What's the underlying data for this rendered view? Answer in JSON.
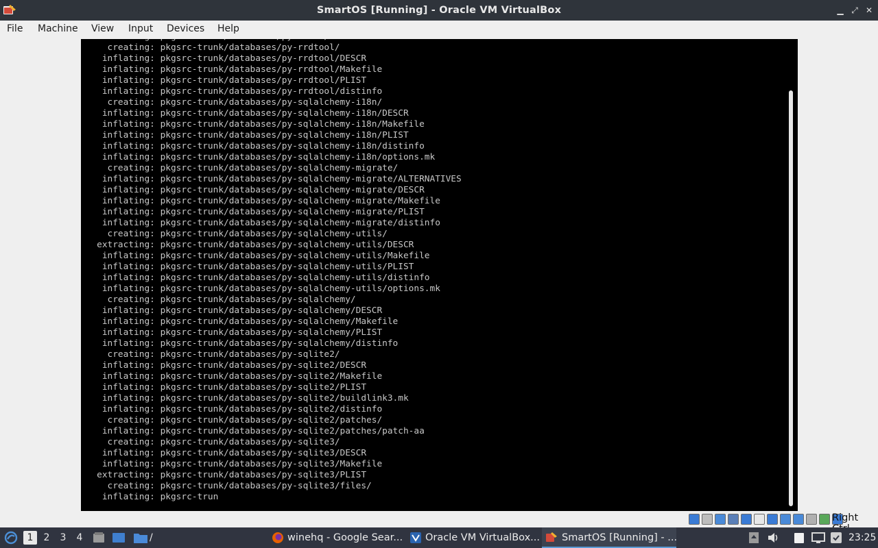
{
  "window": {
    "title": "SmartOS [Running] - Oracle VM VirtualBox",
    "controls": {
      "minimize": "▁",
      "restore": "⤢",
      "close": "✕"
    }
  },
  "menu": [
    "File",
    "Machine",
    "Input",
    "Devices",
    "Help"
  ],
  "menu_view": "View",
  "console_lines": [
    "    inflating: pkgsrc-trunk/databases/py-redis/distinfo",
    "     creating: pkgsrc-trunk/databases/py-rrdtool/",
    "    inflating: pkgsrc-trunk/databases/py-rrdtool/DESCR",
    "    inflating: pkgsrc-trunk/databases/py-rrdtool/Makefile",
    "    inflating: pkgsrc-trunk/databases/py-rrdtool/PLIST",
    "    inflating: pkgsrc-trunk/databases/py-rrdtool/distinfo",
    "     creating: pkgsrc-trunk/databases/py-sqlalchemy-i18n/",
    "    inflating: pkgsrc-trunk/databases/py-sqlalchemy-i18n/DESCR",
    "    inflating: pkgsrc-trunk/databases/py-sqlalchemy-i18n/Makefile",
    "    inflating: pkgsrc-trunk/databases/py-sqlalchemy-i18n/PLIST",
    "    inflating: pkgsrc-trunk/databases/py-sqlalchemy-i18n/distinfo",
    "    inflating: pkgsrc-trunk/databases/py-sqlalchemy-i18n/options.mk",
    "     creating: pkgsrc-trunk/databases/py-sqlalchemy-migrate/",
    "    inflating: pkgsrc-trunk/databases/py-sqlalchemy-migrate/ALTERNATIVES",
    "    inflating: pkgsrc-trunk/databases/py-sqlalchemy-migrate/DESCR",
    "    inflating: pkgsrc-trunk/databases/py-sqlalchemy-migrate/Makefile",
    "    inflating: pkgsrc-trunk/databases/py-sqlalchemy-migrate/PLIST",
    "    inflating: pkgsrc-trunk/databases/py-sqlalchemy-migrate/distinfo",
    "     creating: pkgsrc-trunk/databases/py-sqlalchemy-utils/",
    "   extracting: pkgsrc-trunk/databases/py-sqlalchemy-utils/DESCR",
    "    inflating: pkgsrc-trunk/databases/py-sqlalchemy-utils/Makefile",
    "    inflating: pkgsrc-trunk/databases/py-sqlalchemy-utils/PLIST",
    "    inflating: pkgsrc-trunk/databases/py-sqlalchemy-utils/distinfo",
    "    inflating: pkgsrc-trunk/databases/py-sqlalchemy-utils/options.mk",
    "     creating: pkgsrc-trunk/databases/py-sqlalchemy/",
    "    inflating: pkgsrc-trunk/databases/py-sqlalchemy/DESCR",
    "    inflating: pkgsrc-trunk/databases/py-sqlalchemy/Makefile",
    "    inflating: pkgsrc-trunk/databases/py-sqlalchemy/PLIST",
    "    inflating: pkgsrc-trunk/databases/py-sqlalchemy/distinfo",
    "     creating: pkgsrc-trunk/databases/py-sqlite2/",
    "    inflating: pkgsrc-trunk/databases/py-sqlite2/DESCR",
    "    inflating: pkgsrc-trunk/databases/py-sqlite2/Makefile",
    "    inflating: pkgsrc-trunk/databases/py-sqlite2/PLIST",
    "    inflating: pkgsrc-trunk/databases/py-sqlite2/buildlink3.mk",
    "    inflating: pkgsrc-trunk/databases/py-sqlite2/distinfo",
    "     creating: pkgsrc-trunk/databases/py-sqlite2/patches/",
    "    inflating: pkgsrc-trunk/databases/py-sqlite2/patches/patch-aa",
    "     creating: pkgsrc-trunk/databases/py-sqlite3/",
    "    inflating: pkgsrc-trunk/databases/py-sqlite3/DESCR",
    "    inflating: pkgsrc-trunk/databases/py-sqlite3/Makefile",
    "   extracting: pkgsrc-trunk/databases/py-sqlite3/PLIST",
    "     creating: pkgsrc-trunk/databases/py-sqlite3/files/",
    "    inflating: pkgsrc-trun"
  ],
  "statusbar": {
    "host_key": "Right Ctrl",
    "icons": [
      "hard-disk",
      "optical-drive",
      "audio",
      "network",
      "usb",
      "shared-folders",
      "display",
      "video-capture",
      "recording",
      "mouse-integration",
      "cpu-activity",
      "keyboard-capture"
    ]
  },
  "taskbar": {
    "workspaces": [
      "1",
      "2",
      "3",
      "4"
    ],
    "active_workspace": "1",
    "path_label": "/",
    "tasks": [
      {
        "label": "winehq - Google Sear...",
        "icon": "firefox-icon",
        "active": false
      },
      {
        "label": "Oracle VM VirtualBox...",
        "icon": "virtualbox-icon",
        "active": false
      },
      {
        "label": "SmartOS [Running] - ...",
        "icon": "vm-icon",
        "active": true
      }
    ],
    "clock": "23:25"
  },
  "colors": {
    "titlebar": "#2f343b",
    "console_text": "#c8c8c8",
    "taskbar": "#303440",
    "accent": "#5b9bd5"
  }
}
